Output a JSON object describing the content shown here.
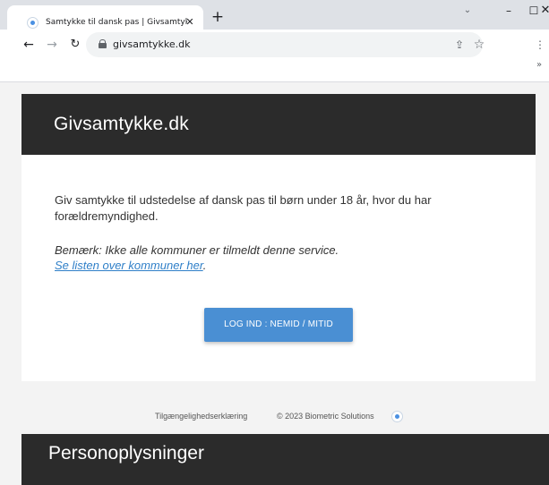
{
  "browser": {
    "tab_title": "Samtykke til dansk pas | Givsamtykke.dk",
    "tab_close": "✕",
    "new_tab": "+",
    "url": "givsamtykke.dk",
    "window_minimize": "–",
    "window_maximize": "☐",
    "window_close": "✕",
    "overflow": "»"
  },
  "site": {
    "title": "Givsamtykke.dk",
    "intro": "Giv samtykke til udstedelse af dansk pas til børn under 18 år, hvor du har forældremyndighed.",
    "note": "Bemærk: Ikke alle kommuner er tilmeldt denne service.",
    "note_link": "Se listen over kommuner her",
    "note_link_suffix": ".",
    "login_button": "LOG IND : NEMID / MITID"
  },
  "footer": {
    "accessibility_link": "Tilgængelighedserklæring",
    "copyright": "© 2023 Biometric Solutions"
  },
  "next_section": {
    "title": "Personoplysninger"
  }
}
